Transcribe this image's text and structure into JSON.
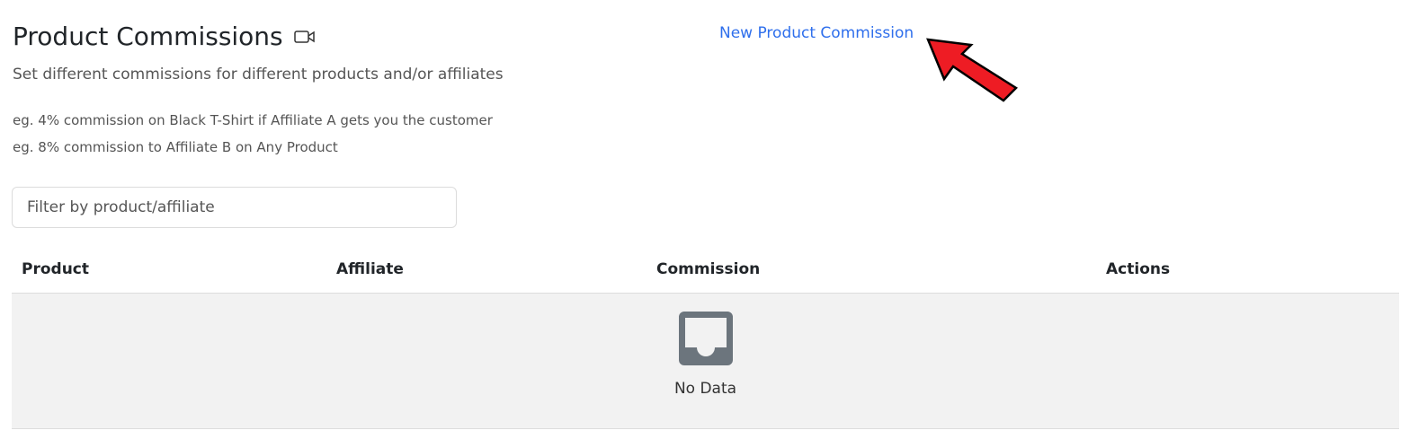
{
  "header": {
    "title": "Product Commissions",
    "title_icon": "video-camera-icon",
    "subtitle": "Set different commissions for different products and/or affiliates",
    "examples": [
      "eg. 4% commission on Black T-Shirt if Affiliate A gets you the customer",
      "eg. 8% commission to Affiliate B on Any Product"
    ],
    "new_link": "New Product Commission"
  },
  "filter": {
    "placeholder": "Filter by product/affiliate",
    "value": ""
  },
  "table": {
    "columns": [
      "Product",
      "Affiliate",
      "Commission",
      "Actions"
    ],
    "rows": [],
    "empty_text": "No Data",
    "empty_icon": "inbox-icon"
  },
  "colors": {
    "link": "#2f6fec",
    "annotation_arrow": "#ee1c24"
  }
}
